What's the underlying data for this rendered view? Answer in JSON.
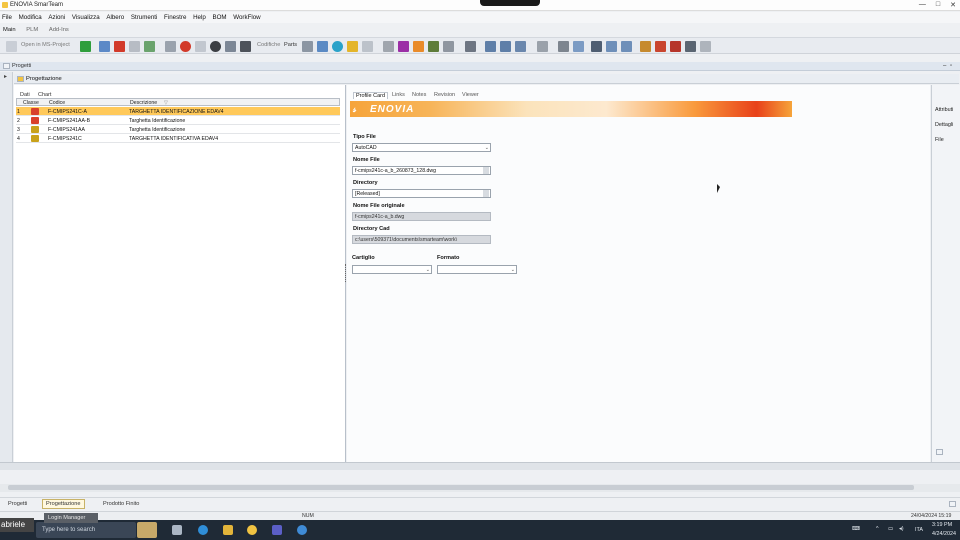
{
  "window": {
    "title": "ENOVIA SmarTeam",
    "controls": [
      "—",
      "□",
      "✕"
    ]
  },
  "menubar": [
    "File",
    "Modifica",
    "Azioni",
    "Visualizza",
    "Albero",
    "Strumenti",
    "Finestre",
    "Help",
    "BOM",
    "WorkFlow"
  ],
  "ribbon_tabs": [
    "Main",
    "PLM",
    "Add-Ins"
  ],
  "toolbar": {
    "open_ms_project": "Open in MS-Project",
    "codifiche": "Codifiche",
    "parts": "Parts"
  },
  "panel": {
    "title": "Progetti",
    "sub_title": "Progettazione"
  },
  "left_tabs": [
    "Dati",
    "Chart"
  ],
  "grid": {
    "columns": [
      "Classe",
      "Codice",
      "Descrizione"
    ],
    "rows": [
      {
        "num": "1",
        "codice": "F-CMIPS241C-A",
        "descrizione": "TARGHETTA IDENTIFICAZIONE EDAV4",
        "icon_color": "#d9412a",
        "selected": true
      },
      {
        "num": "2",
        "codice": "F-CMIPS241AA-B",
        "descrizione": "Targhetta Identificazione",
        "icon_color": "#d9412a",
        "selected": false
      },
      {
        "num": "3",
        "codice": "F-CMIPS241AA",
        "descrizione": "Targhetta Identificazione",
        "icon_color": "#c9a21a",
        "selected": false
      },
      {
        "num": "4",
        "codice": "F-CMIPS241C",
        "descrizione": "TARGHETTA IDENTIFICATIVA EDAV4",
        "icon_color": "#c9a21a",
        "selected": false
      }
    ]
  },
  "right_tabs": [
    "Profile Card",
    "Links",
    "Notes",
    "Revision",
    "Viewer"
  ],
  "banner": {
    "brand": "ENOVIA"
  },
  "form": {
    "tipo_file_label": "Tipo File",
    "tipo_file_value": "AutoCAD",
    "nome_file_label": "Nome File",
    "nome_file_value": "f-cmips241c-a_b_260873_128.dwg",
    "directory_label": "Directory",
    "directory_value": "[Released]",
    "nome_file_orig_label": "Nome File originale",
    "nome_file_orig_value": "f-cmips241c-a_b.dwg",
    "directory_cad_label": "Directory Cad",
    "directory_cad_value": "c:\\users\\509371\\documents\\smarteam\\work\\",
    "cartiglio_label": "Cartiglio",
    "cartiglio_value": "",
    "formato_label": "Formato",
    "formato_value": ""
  },
  "side_buttons": [
    "Attributi",
    "Dettagli",
    "File"
  ],
  "bottom_tabs": [
    "Progetti",
    "Progettazione",
    "Prodotto Finito"
  ],
  "statusbar": {
    "num": "NUM",
    "datetime": "24/04/2024 15:19"
  },
  "taskbar": {
    "search_placeholder": "Type here to search",
    "overlay_name": "abriele",
    "tooltip": "Login Manager",
    "time": "3:19 PM",
    "date": "4/24/2024",
    "lang": "ITA"
  }
}
